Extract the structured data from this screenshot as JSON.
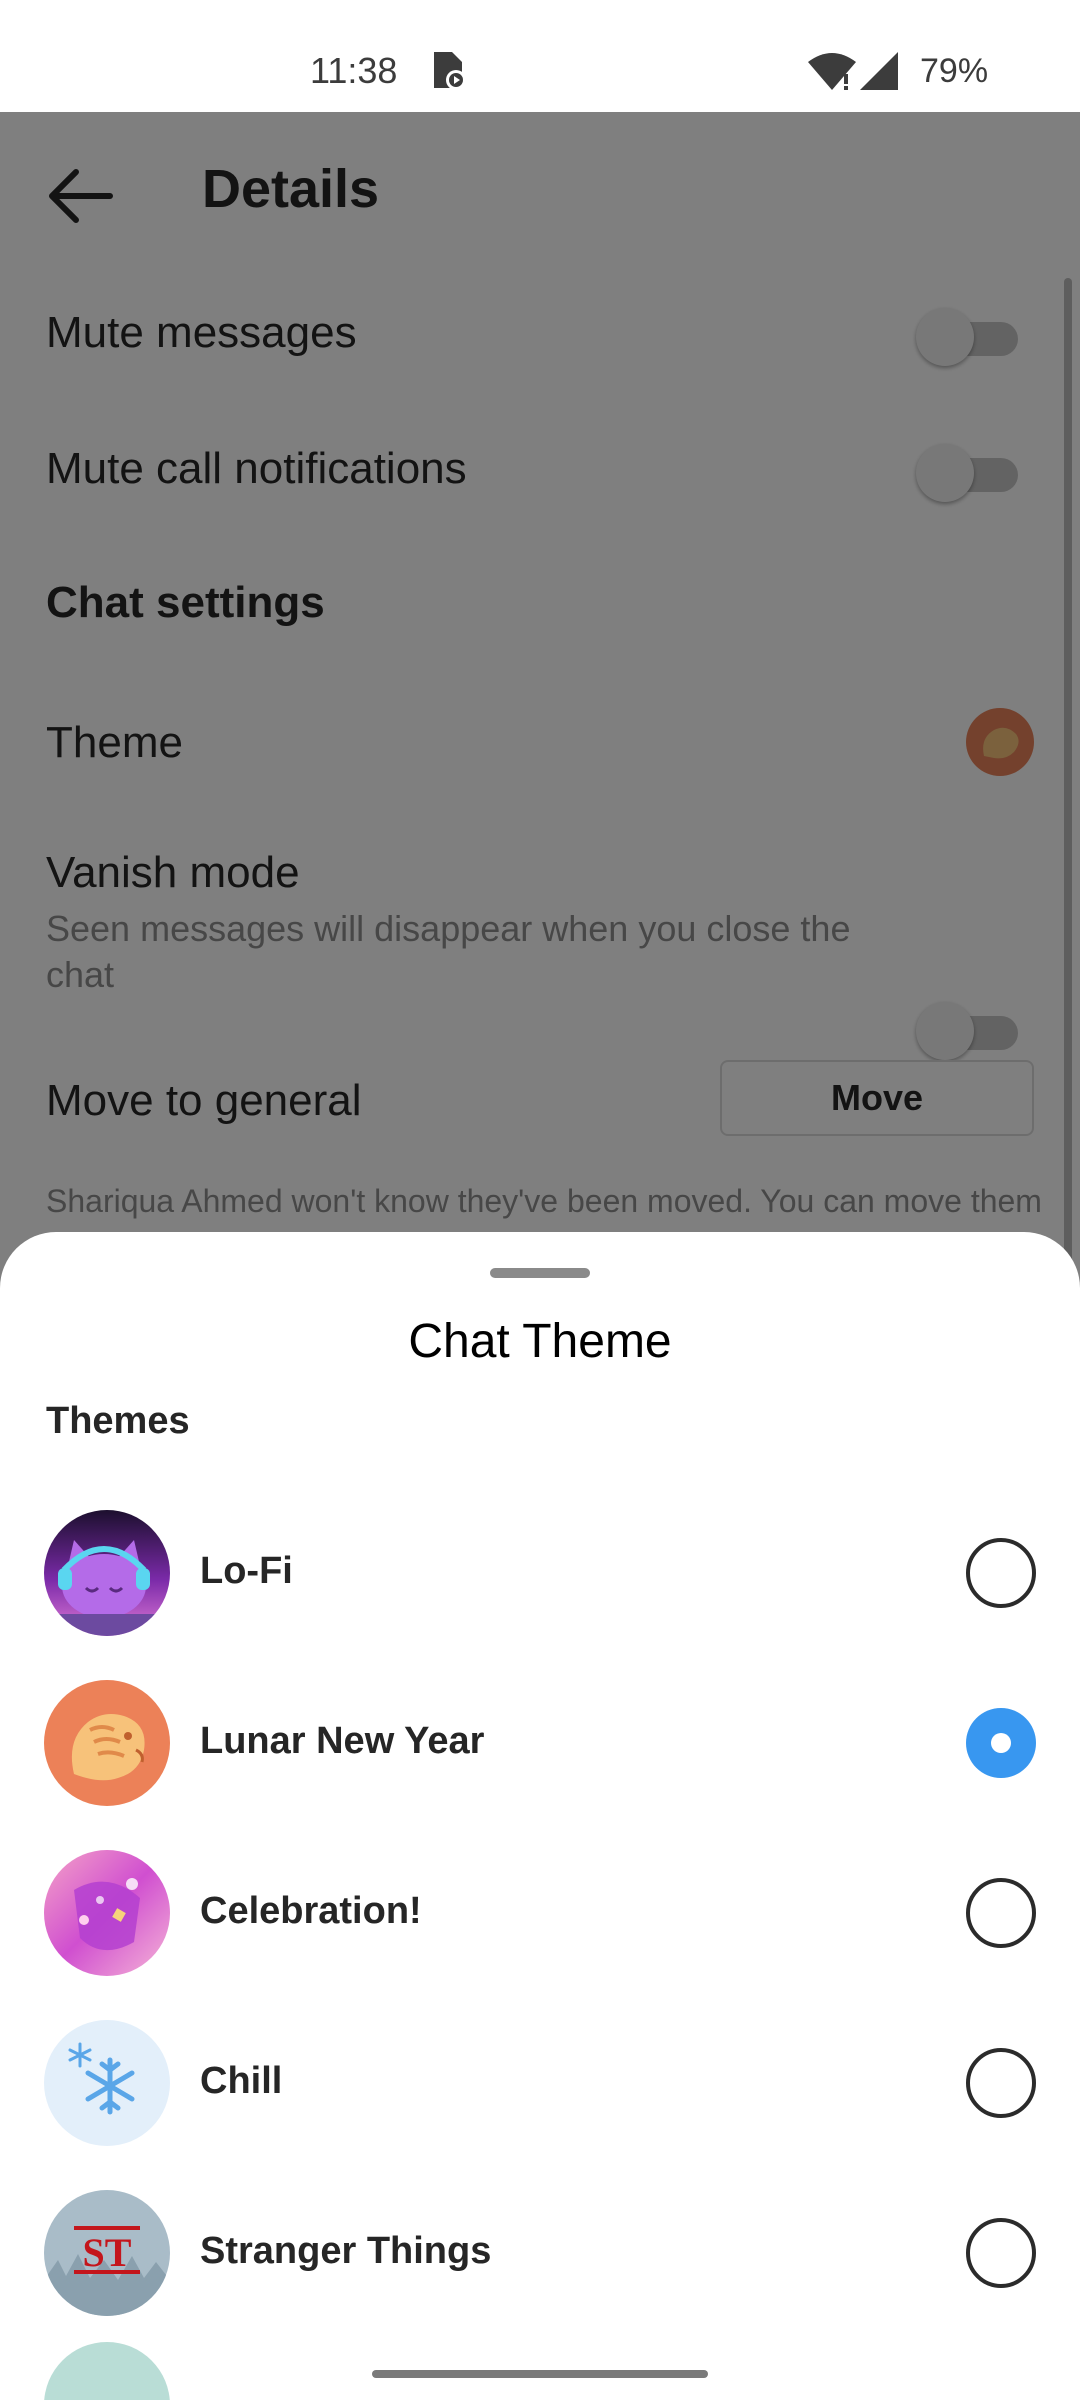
{
  "status_bar": {
    "time": "11:38",
    "battery": "79%"
  },
  "details": {
    "title": "Details",
    "mute_messages": "Mute messages",
    "mute_calls": "Mute call notifications",
    "chat_settings": "Chat settings",
    "theme": "Theme",
    "vanish_mode": "Vanish mode",
    "vanish_desc": "Seen messages will disappear when you close the chat",
    "move_to_general": "Move to general",
    "move_button": "Move",
    "move_note": "Shariqua Ahmed won't know they've been moved. You can move them back to Primary anytime."
  },
  "sheet": {
    "title": "Chat Theme",
    "section": "Themes",
    "themes": [
      {
        "label": "Lo-Fi",
        "selected": false,
        "icon": "lofi-cat-icon"
      },
      {
        "label": "Lunar New Year",
        "selected": true,
        "icon": "tiger-icon"
      },
      {
        "label": "Celebration!",
        "selected": false,
        "icon": "confetti-icon"
      },
      {
        "label": "Chill",
        "selected": false,
        "icon": "snowflake-icon"
      },
      {
        "label": "Stranger Things",
        "selected": false,
        "icon": "st-logo-icon"
      }
    ]
  },
  "colors": {
    "accent": "#3897f0",
    "lunar": "#e8825a"
  }
}
